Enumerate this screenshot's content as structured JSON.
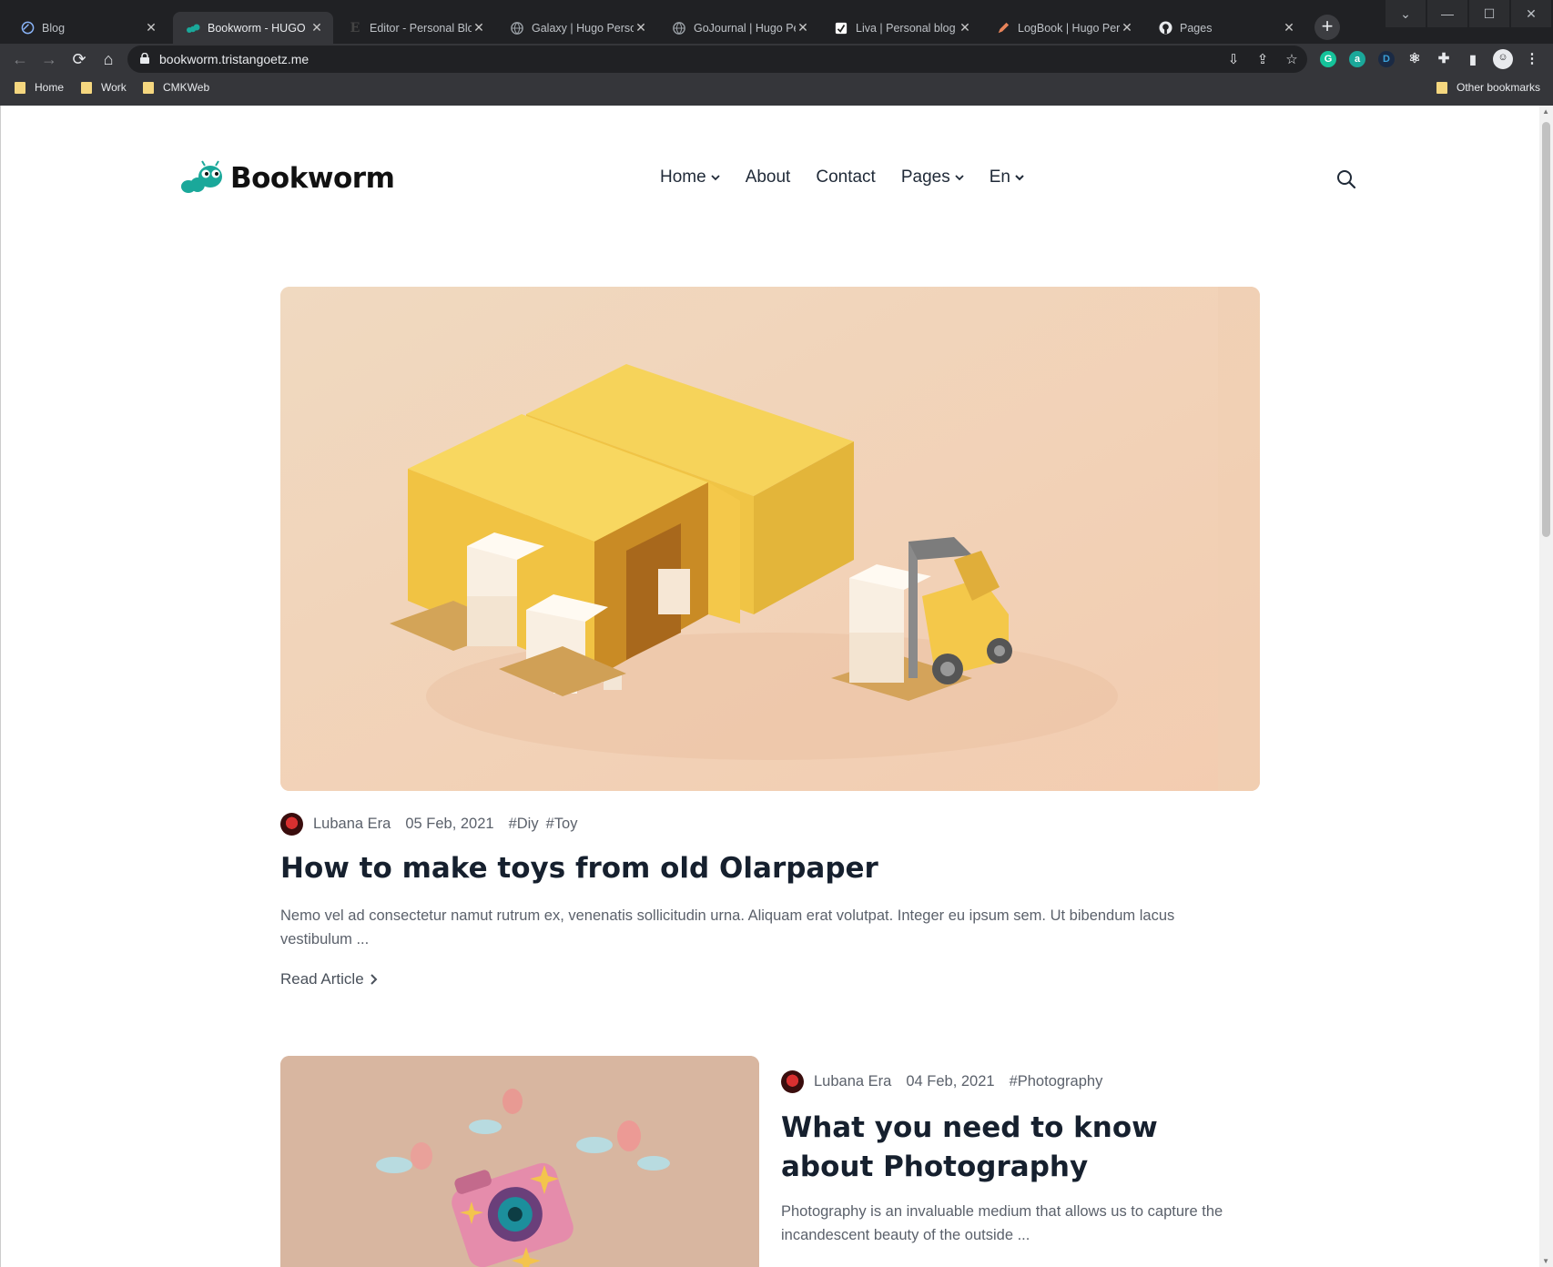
{
  "browser": {
    "tabs": [
      {
        "title": "Blog",
        "icon": "blog-icon"
      },
      {
        "title": "Bookworm - HUGO Bl",
        "icon": "bookworm-icon",
        "active": true
      },
      {
        "title": "Editor - Personal Blog",
        "icon": "editor-icon"
      },
      {
        "title": "Galaxy | Hugo Person",
        "icon": "globe-icon"
      },
      {
        "title": "GoJournal | Hugo Per",
        "icon": "globe-icon"
      },
      {
        "title": "Liva | Personal blog te",
        "icon": "liva-icon"
      },
      {
        "title": "LogBook | Hugo Pers",
        "icon": "pen-icon"
      },
      {
        "title": "Pages",
        "icon": "github-icon"
      }
    ],
    "new_tab": "+",
    "url": "bookworm.tristangoetz.me",
    "bookmarks": [
      {
        "label": "Home"
      },
      {
        "label": "Work"
      },
      {
        "label": "CMKWeb"
      }
    ],
    "other_bookmarks": "Other bookmarks",
    "colors": {
      "frame": "#202124",
      "toolbar": "#35363a"
    }
  },
  "site": {
    "logo": "Bookworm",
    "nav": [
      {
        "label": "Home",
        "dropdown": true
      },
      {
        "label": "About",
        "dropdown": false
      },
      {
        "label": "Contact",
        "dropdown": false
      },
      {
        "label": "Pages",
        "dropdown": true
      },
      {
        "label": "En",
        "dropdown": true
      }
    ],
    "accent": "#1aa89a"
  },
  "posts": [
    {
      "author": "Lubana Era",
      "date": "05 Feb, 2021",
      "tags": [
        "#Diy",
        "#Toy"
      ],
      "title": "How to make toys from old Olarpaper",
      "excerpt": "Nemo vel ad consectetur namut rutrum ex, venenatis sollicitudin urna. Aliquam erat volutpat. Integer eu ipsum sem. Ut bibendum lacus vestibulum ...",
      "read_more": "Read Article"
    },
    {
      "author": "Lubana Era",
      "date": "04 Feb, 2021",
      "tags": [
        "#Photography"
      ],
      "title": "What you need to know about Photography",
      "excerpt": "Photography is an invaluable medium that allows us to capture the incandescent beauty of the outside ..."
    }
  ]
}
